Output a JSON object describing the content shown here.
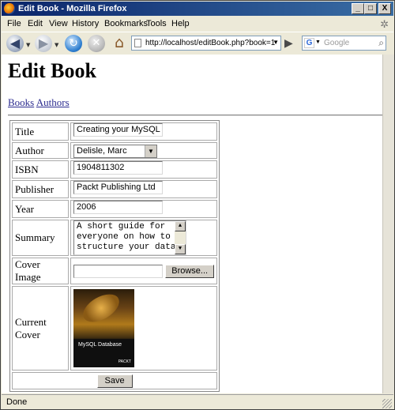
{
  "window": {
    "title": "Edit Book - Mozilla Firefox",
    "minimize": "_",
    "maximize": "□",
    "close": "X"
  },
  "menu": [
    "File",
    "Edit",
    "View",
    "History",
    "Bookmarks",
    "Tools",
    "Help"
  ],
  "toolbar": {
    "url": "http://localhost/editBook.php?book=1",
    "search_placeholder": "Google",
    "search_engine": "G"
  },
  "page": {
    "heading": "Edit Book",
    "links": [
      "Books",
      "Authors"
    ]
  },
  "form": {
    "title_label": "Title",
    "title_value": "Creating your MySQL D",
    "author_label": "Author",
    "author_value": "Delisle, Marc",
    "isbn_label": "ISBN",
    "isbn_value": "1904811302",
    "publisher_label": "Publisher",
    "publisher_value": "Packt Publishing Ltd",
    "year_label": "Year",
    "year_value": "2006",
    "summary_label": "Summary",
    "summary_value": "A short guide for\neveryone on how to\nstructure your data",
    "cover_image_label": "Cover Image",
    "browse_label": "Browse...",
    "current_cover_label": "Current Cover",
    "cover_title": "MySQL Database",
    "cover_publisher": "PACKT",
    "save_label": "Save"
  },
  "status": {
    "text": "Done"
  },
  "icons": {
    "back": "back-arrow-icon",
    "forward": "forward-arrow-icon",
    "reload": "reload-icon",
    "stop": "stop-icon",
    "home": "home-icon",
    "go": "go-arrow-icon",
    "search": "magnifier-icon"
  }
}
